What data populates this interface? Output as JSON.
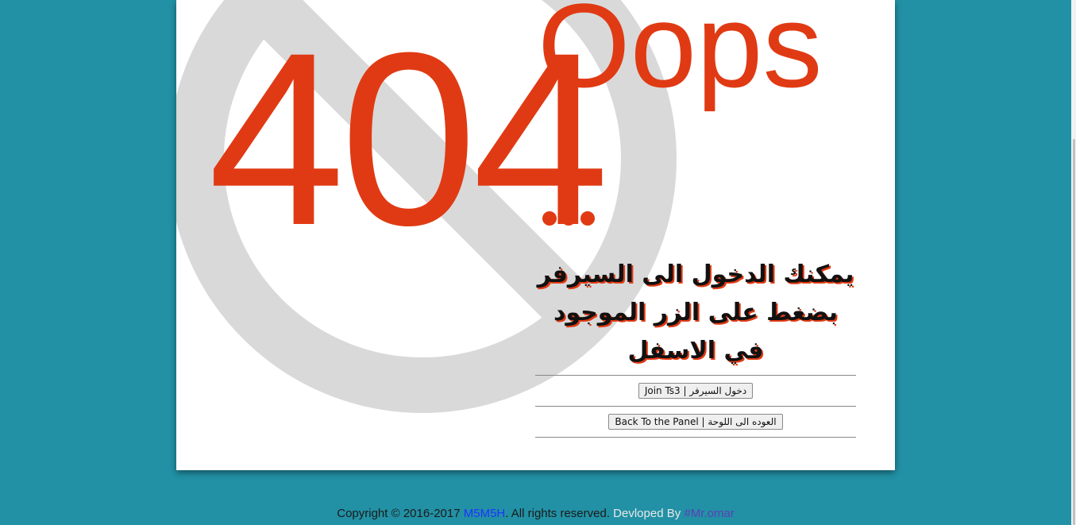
{
  "error": {
    "code": "404",
    "oops": "Oops",
    "ellipsis": "..."
  },
  "message": "يمكنك الدخول الى السيرفر بضغط على الزر الموجود في الاسفل",
  "buttons": {
    "join": "Join Ts3 | دخول السيرفر",
    "back": "Back To the Panel | العوده الى اللوحة"
  },
  "footer": {
    "copyright": "Copyright © 2016-2017",
    "brand": "M5M5H",
    "rights": ". All rights reserved.",
    "developed_by": "Devloped By",
    "developer": "#Mr.omar"
  },
  "colors": {
    "background": "#2291a5",
    "accent": "#e03a14",
    "symbol": "#d9d9d9"
  },
  "icons": {
    "background_symbol": "prohibited-icon"
  }
}
